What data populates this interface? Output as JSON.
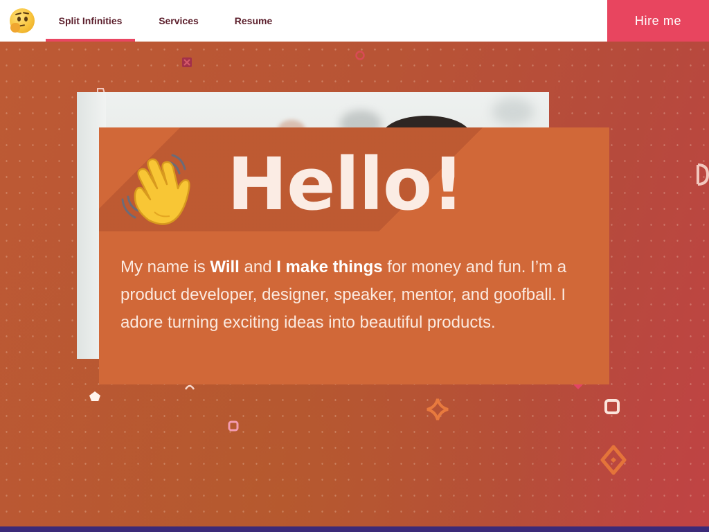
{
  "nav": {
    "logo_icon": "thinking-face-icon",
    "items": [
      {
        "label": "Split Infinities",
        "active": true
      },
      {
        "label": "Services",
        "active": false
      },
      {
        "label": "Resume",
        "active": false
      }
    ],
    "cta_label": "Hire me"
  },
  "hero": {
    "wave_icon": "waving-hand-icon",
    "title": "Hello!",
    "intro": {
      "pre_name": "My name is ",
      "name": "Will",
      "mid": " and ",
      "highlight": "I make things",
      "rest": " for money and fun. I’m a product developer, designer, speaker, mentor, and goofball. I adore turning exciting ideas into beautiful products."
    }
  },
  "colors": {
    "accent": "#e8455f",
    "nav_text": "#5b1e2b",
    "card": "#d16838",
    "background": "#b85435",
    "footer_band": "#3b2a78"
  }
}
